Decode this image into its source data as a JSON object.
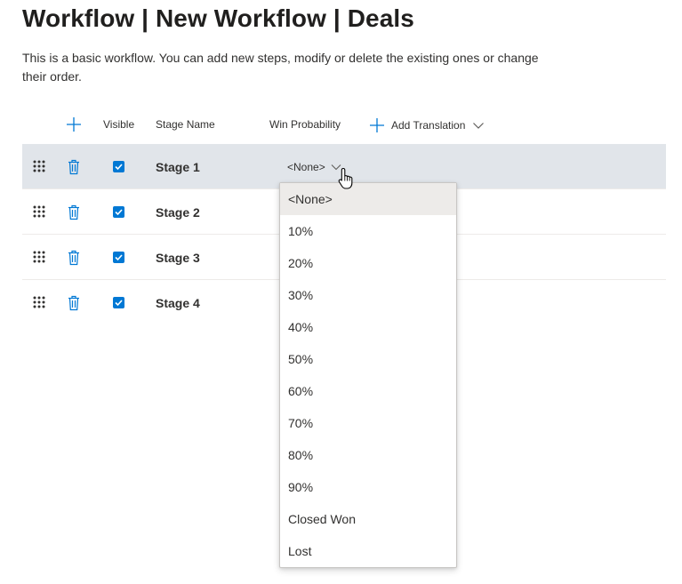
{
  "page": {
    "title": "Workflow | New Workflow | Deals",
    "description": "This is a basic workflow. You can add new steps, modify or delete the existing ones or change their order."
  },
  "table": {
    "columns": {
      "visible": "Visible",
      "stage_name": "Stage Name",
      "win_probability": "Win Probability",
      "add_translation": "Add Translation"
    },
    "rows": [
      {
        "name": "Stage 1",
        "visible": true,
        "win_probability": "<None>",
        "selected": true
      },
      {
        "name": "Stage 2",
        "visible": true
      },
      {
        "name": "Stage 3",
        "visible": true
      },
      {
        "name": "Stage 4",
        "visible": true
      }
    ]
  },
  "dropdown": {
    "selected": "<None>",
    "options": [
      "<None>",
      "10%",
      "20%",
      "30%",
      "40%",
      "50%",
      "60%",
      "70%",
      "80%",
      "90%",
      "Closed Won",
      "Lost"
    ]
  },
  "colors": {
    "accent": "#0078d4",
    "selected_row": "#e1e5ea",
    "icon": "#0078d4"
  },
  "icons": {
    "add": "plus-icon",
    "drag": "drag-handle-icon",
    "delete": "trash-icon",
    "checkbox": "checkmark-icon",
    "dropdown": "chevron-down-icon",
    "cursor": "hand-pointer-icon"
  }
}
